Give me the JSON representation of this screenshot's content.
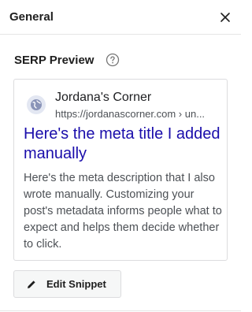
{
  "panel": {
    "title": "General",
    "close_icon": "close-icon"
  },
  "serp_section": {
    "title": "SERP Preview",
    "help_icon": "question-circle-icon"
  },
  "serp_preview": {
    "favicon_icon": "globe-icon",
    "site_name": "Jordana's Corner",
    "url": "https://jordanascorner.com › un...",
    "meta_title": "Here's the meta title I added manually",
    "meta_description": "Here's the meta description that I also wrote manually. Customizing your post's metadata informs people what to expect and helps them decide whether to click."
  },
  "edit_snippet": {
    "label": "Edit Snippet",
    "icon": "pencil-icon"
  },
  "colors": {
    "link_blue": "#1a0dab",
    "text_gray": "#4d5156",
    "border": "#dcdcde"
  }
}
